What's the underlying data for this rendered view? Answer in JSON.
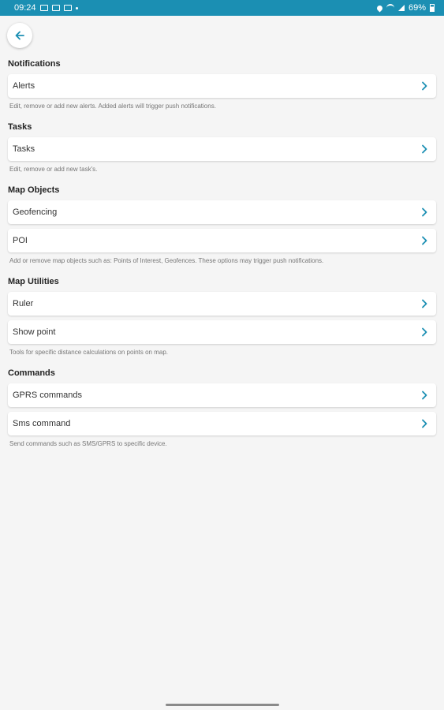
{
  "status_bar": {
    "time": "09:24",
    "battery": "69%"
  },
  "colors": {
    "accent": "#1b8fb3",
    "background": "#f5f5f5"
  },
  "sections": [
    {
      "title": "Notifications",
      "items": [
        {
          "label": "Alerts"
        }
      ],
      "description": "Edit, remove or add new alerts. Added alerts will trigger push notifications."
    },
    {
      "title": "Tasks",
      "items": [
        {
          "label": "Tasks"
        }
      ],
      "description": "Edit, remove or add new task's."
    },
    {
      "title": "Map Objects",
      "items": [
        {
          "label": "Geofencing"
        },
        {
          "label": "POI"
        }
      ],
      "description": "Add or remove map objects such as: Points of Interest, Geofences. These options may trigger push notifications."
    },
    {
      "title": "Map Utilities",
      "items": [
        {
          "label": "Ruler"
        },
        {
          "label": "Show point"
        }
      ],
      "description": "Tools for specific distance calculations on points on map."
    },
    {
      "title": "Commands",
      "items": [
        {
          "label": "GPRS commands"
        },
        {
          "label": "Sms command"
        }
      ],
      "description": "Send commands such as SMS/GPRS to specific device."
    }
  ]
}
